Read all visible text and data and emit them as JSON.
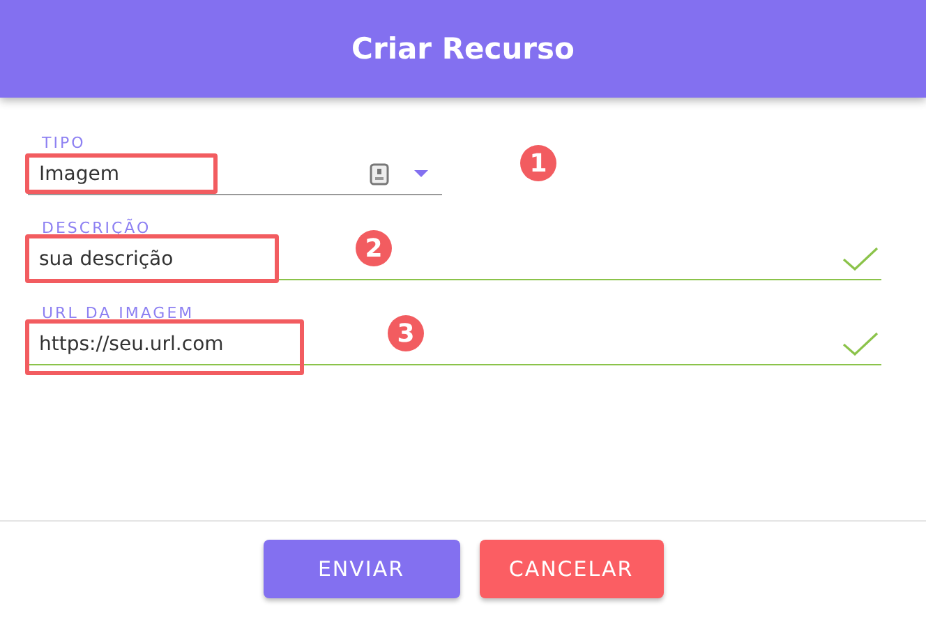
{
  "header": {
    "title": "Criar Recurso"
  },
  "fields": [
    {
      "kind": "select",
      "label": "TIPO",
      "value": "Imagem",
      "valid": false,
      "marker": "1"
    },
    {
      "kind": "text",
      "label": "DESCRIÇÃO",
      "value": "sua descrição",
      "valid": true,
      "marker": "2"
    },
    {
      "kind": "text",
      "label": "URL DA IMAGEM",
      "value": "https://seu.url.com",
      "valid": true,
      "marker": "3"
    }
  ],
  "buttons": [
    {
      "kind": "primary",
      "label": "ENVIAR"
    },
    {
      "kind": "danger",
      "label": "CANCELAR"
    }
  ]
}
